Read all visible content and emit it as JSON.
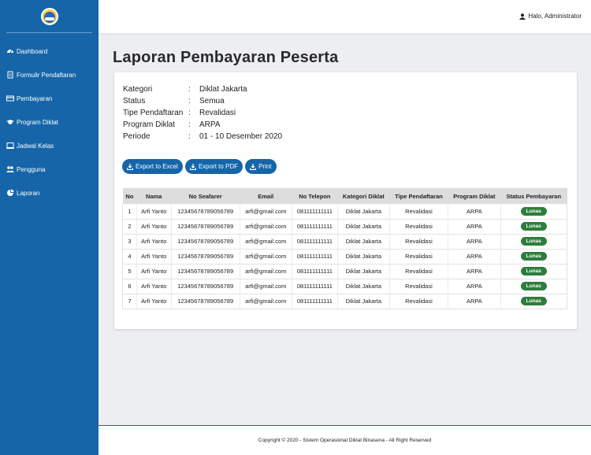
{
  "sidebar": {
    "items": [
      {
        "label": "Dashboard",
        "icon": "dashboard-icon"
      },
      {
        "label": "Formulir Pendaftaran",
        "icon": "document-icon"
      },
      {
        "label": "Pembayaran",
        "icon": "credit-card-icon"
      },
      {
        "label": "Program Diklat",
        "icon": "graduation-cap-icon"
      },
      {
        "label": "Jadwal Kelas",
        "icon": "calendar-icon"
      },
      {
        "label": "Pengguna",
        "icon": "users-icon"
      },
      {
        "label": "Laporan",
        "icon": "pie-chart-icon"
      }
    ]
  },
  "topbar": {
    "user_label": "Halo, Administrator"
  },
  "page": {
    "title": "Laporan Pembayaran Peserta"
  },
  "info": [
    {
      "key": "Kategori",
      "sep": ":",
      "value": "Diklat Jakarta"
    },
    {
      "key": "Status",
      "sep": ":",
      "value": "Semua"
    },
    {
      "key": "Tipe Pendaftaran",
      "sep": ":",
      "value": "Revalidasi"
    },
    {
      "key": "Program Diklat",
      "sep": ":",
      "value": "ARPA"
    },
    {
      "key": "Periode",
      "sep": ":",
      "value": "01 - 10 Desember 2020"
    }
  ],
  "buttons": {
    "excel": "Export to Excel",
    "pdf": "Export to PDF",
    "print": "Print"
  },
  "table": {
    "headers": [
      "No",
      "Nama",
      "No Seafarer",
      "Email",
      "No Telepon",
      "Kategori Diklat",
      "Tipe Pendaftaran",
      "Program Diklat",
      "Status Pembayaran"
    ],
    "rows": [
      [
        "1",
        "Arfi Yanto",
        "12345678789056789",
        "arfi@gmail.com",
        "081111111111",
        "Diklat Jakarta",
        "Revalidasi",
        "ARPA",
        "Lunas"
      ],
      [
        "2",
        "Arfi Yanto",
        "12345678789056789",
        "arfi@gmail.com",
        "081111111111",
        "Diklat Jakarta",
        "Revalidasi",
        "ARPA",
        "Lunas"
      ],
      [
        "3",
        "Arfi Yanto",
        "12345678789056789",
        "arfi@gmail.com",
        "081111111111",
        "Diklat Jakarta",
        "Revalidasi",
        "ARPA",
        "Lunas"
      ],
      [
        "4",
        "Arfi Yanto",
        "12345678789056789",
        "arfi@gmail.com",
        "081111111111",
        "Diklat Jakarta",
        "Revalidasi",
        "ARPA",
        "Lunas"
      ],
      [
        "5",
        "Arfi Yanto",
        "12345678789056789",
        "arfi@gmail.com",
        "081111111111",
        "Diklat Jakarta",
        "Revalidasi",
        "ARPA",
        "Lunas"
      ],
      [
        "6",
        "Arfi Yanto",
        "12345678789056789",
        "arfi@gmail.com",
        "081111111111",
        "Diklat Jakarta",
        "Revalidasi",
        "ARPA",
        "Lunas"
      ],
      [
        "7",
        "Arfi Yanto",
        "12345678789056789",
        "arfi@gmail.com",
        "081111111111",
        "Diklat Jakarta",
        "Revalidasi",
        "ARPA",
        "Lunas"
      ]
    ]
  },
  "footer": {
    "text": "Copyright © 2020 - Sistem Operasional Diklat Binasena - All Right Reserved"
  },
  "colors": {
    "primary": "#1665a8",
    "badge": "#2e7d3c",
    "background": "#eceef2"
  }
}
